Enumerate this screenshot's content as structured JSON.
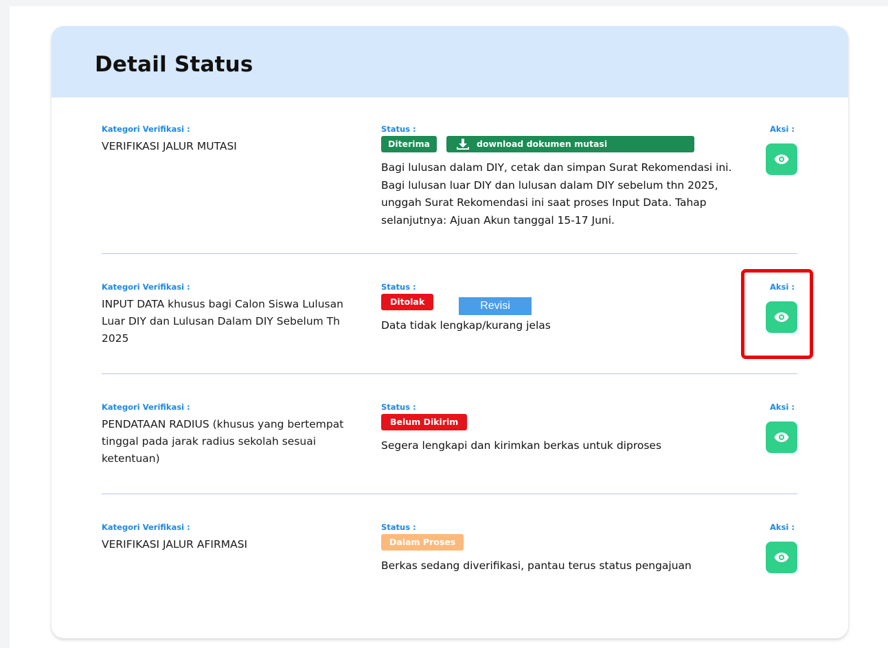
{
  "card": {
    "title": "Detail Status"
  },
  "labels": {
    "category": "Kategori Verifikasi :",
    "status": "Status :",
    "action": "Aksi :"
  },
  "rows": [
    {
      "category": "VERIFIKASI JALUR MUTASI",
      "badge": {
        "text": "Diterima",
        "color": "#1c8b54"
      },
      "download_label": "download dokumen mutasi",
      "description": "Bagi lulusan dalam DIY, cetak dan simpan Surat Rekomendasi ini. Bagi lulusan luar DIY dan lulusan dalam DIY sebelum thn 2025, unggah Surat Rekomendasi ini saat proses Input Data. Tahap selanjutnya: Ajuan Akun tanggal 15-17 Juni.",
      "action_icon": "eye-icon"
    },
    {
      "category": "INPUT DATA khusus bagi Calon Siswa Lulusan Luar DIY dan Lulusan Dalam DIY Sebelum Th 2025",
      "badge": {
        "text": "Ditolak",
        "color": "#e8121b"
      },
      "description": "Data tidak lengkap/kurang jelas",
      "action_icon": "eye-icon"
    },
    {
      "category": "PENDATAAN RADIUS (khusus yang bertempat tinggal pada jarak radius sekolah sesuai ketentuan)",
      "badge": {
        "text": "Belum Dikirim",
        "color": "#e8121b"
      },
      "description": "Segera lengkapi dan kirimkan berkas untuk diproses",
      "action_icon": "eye-icon"
    },
    {
      "category": "VERIFIKASI JALUR AFIRMASI",
      "badge": {
        "text": "Dalam Proses",
        "color": "#fdb97c"
      },
      "description": "Berkas sedang diverifikasi, pantau terus status pengajuan",
      "action_icon": "eye-icon"
    }
  ],
  "annotation": {
    "revisi_label": "Revisi"
  },
  "colors": {
    "accent_blue": "#1e88e5",
    "header_bg": "#d6e8fc",
    "action_green": "#2fd08a",
    "highlight_red": "#ee0000"
  }
}
